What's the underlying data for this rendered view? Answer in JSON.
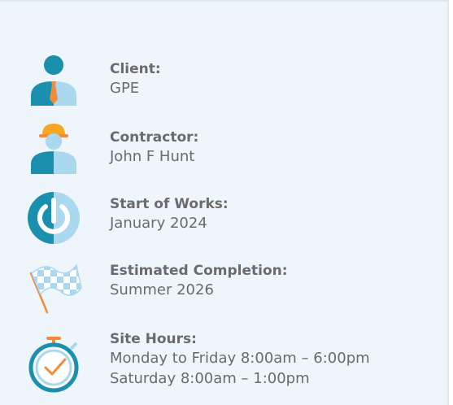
{
  "colors": {
    "background": "#eef5fb",
    "teal": "#1b8fae",
    "light_blue": "#a9d8ef",
    "orange": "#f28a3a",
    "text": "#6b6b6b"
  },
  "items": [
    {
      "label": "Client:",
      "value": "GPE",
      "icon": "business-person-icon"
    },
    {
      "label": "Contractor:",
      "value": "John F Hunt",
      "icon": "hard-hat-worker-icon"
    },
    {
      "label": "Start of Works:",
      "value": "January 2024",
      "icon": "power-icon"
    },
    {
      "label": "Estimated Completion:",
      "value": "Summer 2026",
      "icon": "checkered-flag-icon"
    },
    {
      "label": "Site Hours:",
      "value": "Monday to Friday 8:00am – 6:00pm",
      "value2": "Saturday 8:00am – 1:00pm",
      "icon": "stopwatch-icon"
    }
  ]
}
